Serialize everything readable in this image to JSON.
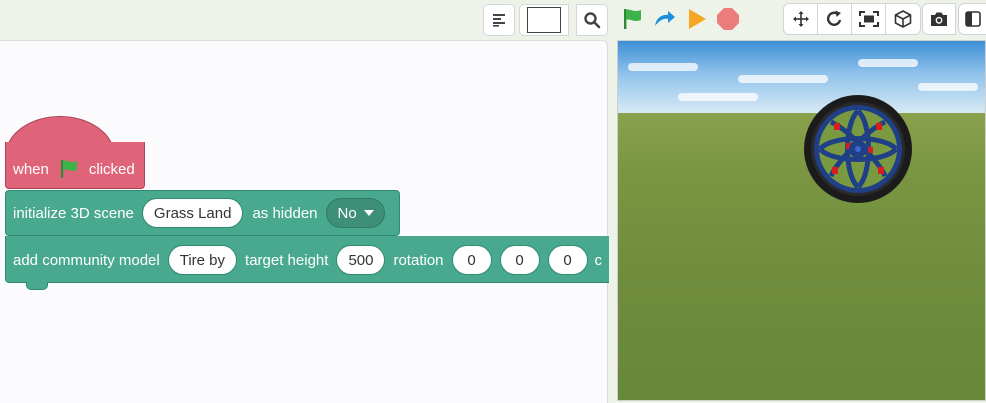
{
  "toolbar": {
    "input_value": "",
    "icons": [
      "align-left-icon",
      "search-icon",
      "green-flag-icon",
      "step-arrow-icon",
      "play-icon",
      "stop-icon"
    ],
    "view_tools": [
      "move-icon",
      "rotate-icon",
      "fullscreen-icon",
      "cube-icon",
      "camera-icon",
      "split-view-icon"
    ]
  },
  "blocks": {
    "hat": {
      "label_when": "when",
      "label_clicked": "clicked",
      "icon": "green-flag-icon"
    },
    "init_scene": {
      "label": "initialize 3D scene",
      "scene_value": "Grass Land",
      "hidden_label": "as hidden",
      "hidden_value": "No"
    },
    "add_model": {
      "label": "add community model",
      "model_value": "Tire by",
      "height_label": "target height",
      "height_value": "500",
      "rotation_label": "rotation",
      "rot_x": "0",
      "rot_y": "0",
      "rot_z": "0",
      "trailing": "c"
    }
  },
  "colors": {
    "hat": "#e06479",
    "block": "#48a98e",
    "flag": "#3fb24a",
    "stop": "#ec7c7c",
    "play": "#f5a623",
    "step": "#1d8fdc",
    "grass": "#7a9642",
    "tire_rim": "#1f3f86"
  },
  "scene_view": {
    "content": "3D tire model on grass land"
  }
}
